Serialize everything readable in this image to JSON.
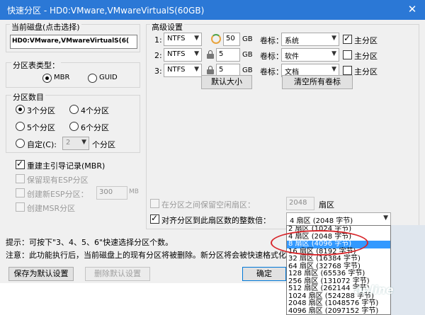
{
  "window": {
    "title": "快速分区 - HD0:VMware,VMwareVirtualS(60GB)",
    "close_glyph": "✕"
  },
  "left": {
    "disk_group_label": "当前磁盘(点击选择)",
    "disk_name": "HD0:VMware,VMwareVirtualS(6(",
    "table_type_label": "分区表类型：",
    "mbr": "MBR",
    "guid": "GUID",
    "count_label": "分区数目",
    "opt3": "3个分区",
    "opt4": "4个分区",
    "opt5": "5个分区",
    "opt6": "6个分区",
    "custom": "自定(C):",
    "custom_value": "2",
    "custom_unit": "个分区",
    "rebuild_mbr": "重建主引导记录(MBR)",
    "keep_esp": "保留现有ESP分区",
    "create_esp": "创建新ESP分区：",
    "esp_size": "300",
    "esp_unit": "MB",
    "create_msr": "创建MSR分区"
  },
  "advanced": {
    "title": "高级设置",
    "gb": "GB",
    "vol_label": "卷标：",
    "primary": "主分区",
    "rows": [
      {
        "num": "1:",
        "fs": "NTFS",
        "size": "50",
        "label": "系统",
        "primary": true
      },
      {
        "num": "2:",
        "fs": "NTFS",
        "size": "5",
        "label": "软件",
        "primary": false
      },
      {
        "num": "3:",
        "fs": "NTFS",
        "size": "5",
        "label": "文档",
        "primary": false
      }
    ],
    "default_size_btn": "默认大小",
    "clear_labels_btn": "清空所有卷标",
    "reserve_label": "在分区之间保留空闲扇区：",
    "reserve_value": "2048",
    "reserve_unit": "扇区",
    "align_label": "对齐分区到此扇区数的整数倍：",
    "align_value": "4 扇区  (2048 字节)"
  },
  "dropdown_options": [
    "2 扇区  (1024 字节)",
    "4 扇区  (2048 字节)",
    "8 扇区  (4096 字节)",
    "16 扇区  (8192 字节)",
    "32 扇区  (16384 字节)",
    "64 扇区  (32768 字节)",
    "128 扇区  (65536 字节)",
    "256 扇区  (131072 字节)",
    "512 扇区  (262144 字节)",
    "1024 扇区  (524288 字节)",
    "2048 扇区  (1048576 字节)",
    "4096 扇区  (2097152 字节)"
  ],
  "selected_option_index": 2,
  "footer": {
    "tip": "提示：可按下\"3、4、5、6\"快速选择分区个数。",
    "note": "注意：此功能执行后，当前磁盘上的现有分区将被删除。新分区将会被快速格式化。",
    "save_default": "保存为默认设置",
    "delete_default": "删除默认设置",
    "ok": "确定"
  },
  "watermark": "online",
  "colors": {
    "titlebar": "#2b78d6",
    "selected": "#3399ff",
    "annotation": "#d8262b"
  }
}
